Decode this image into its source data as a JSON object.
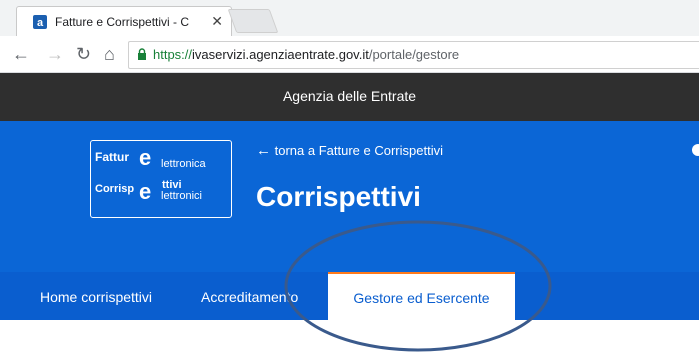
{
  "browser": {
    "tab_title": "Fatture e Corrispettivi - C",
    "tab_close_icon": "close-icon",
    "url_scheme": "https://",
    "url_host": "ivaservizi.agenziaentrate.gov.it",
    "url_path": "/portale/gestore"
  },
  "site": {
    "topbar_title": "Agenzia delle Entrate",
    "logo": {
      "line1_prefix": "Fattur",
      "line1_e": "e",
      "line1_rest": "lettronica",
      "line2_prefix": "Corrisp",
      "line2_rest_top": "ttivi",
      "line2_e": "e",
      "line2_rest_bottom": "lettronici"
    },
    "back_link": "torna a Fatture e Corrispettivi",
    "page_title": "Corrispettivi"
  },
  "nav": {
    "items": [
      {
        "label": "Home corrispettivi",
        "active": false
      },
      {
        "label": "Accreditamento",
        "active": false
      },
      {
        "label": "Gestore ed Esercente",
        "active": true
      }
    ]
  },
  "colors": {
    "banner": "#0b66d6",
    "navbar": "#0a5ecf",
    "topbar": "#2f2f2f",
    "active_tab_border": "#ff7a1a",
    "annotation": "#3a5a8c"
  }
}
